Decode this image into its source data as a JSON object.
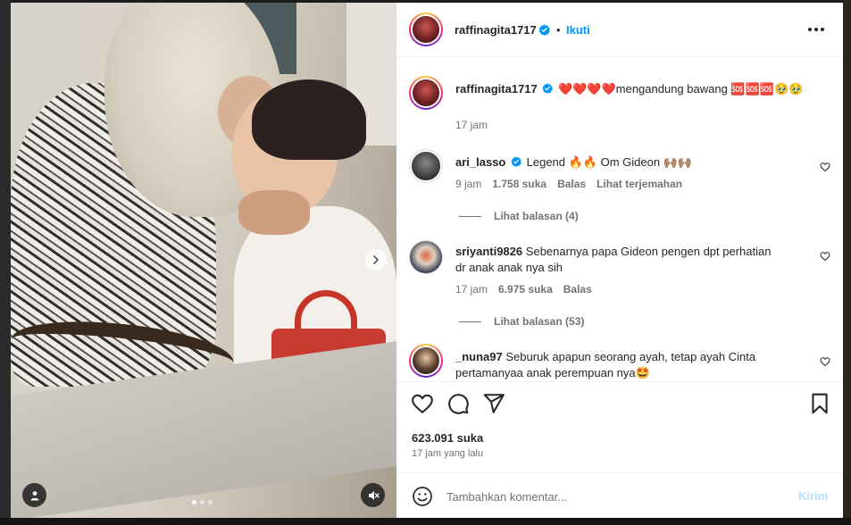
{
  "post": {
    "username": "raffinagita1717",
    "follow_label": "Ikuti",
    "dot": "•",
    "caption": "❤️❤️❤️❤️mengandung bawang 🆘🆘🆘🥹🥹",
    "caption_time": "17 jam"
  },
  "comments": [
    {
      "username": "ari_lasso",
      "verified": true,
      "text": "Legend 🔥🔥 Om Gideon 🙌🏽🙌🏽",
      "time": "9 jam",
      "likes": "1.758 suka",
      "reply": "Balas",
      "translate": "Lihat terjemahan",
      "view_replies": "Lihat balasan (4)"
    },
    {
      "username": "sriyanti9826",
      "text_line1": "Sebenarnya papa Gideon pengen dpt perhatian",
      "text_line2": "dr anak anak nya sih",
      "time": "17 jam",
      "likes": "6.975 suka",
      "reply": "Balas",
      "view_replies": "Lihat balasan (53)"
    },
    {
      "username": "_nuna97",
      "text_line1": "Seburuk apapun seorang ayah, tetap ayah Cinta",
      "text_line2": "pertamanyaa anak perempuan nya🤩"
    }
  ],
  "stats": {
    "likes": "623.091 suka",
    "posted": "17 jam yang lalu"
  },
  "composer": {
    "placeholder": "Tambahkan komentar...",
    "send_label": "Kirim"
  },
  "media": {
    "slide_count": 3,
    "active_slide": 1
  },
  "colors": {
    "accent": "#0095f6",
    "verified": "#0095f6",
    "send_disabled": "#b2dffc",
    "meta_text": "#737373"
  },
  "icons": {
    "header_menu": "more-horizontal-icon",
    "like": "heart-icon",
    "comment": "comment-bubble-icon",
    "share": "paper-plane-icon",
    "save": "bookmark-icon",
    "emoji": "smiley-icon",
    "next": "chevron-right-icon",
    "user_tags": "person-icon",
    "mute": "speaker-muted-icon"
  }
}
